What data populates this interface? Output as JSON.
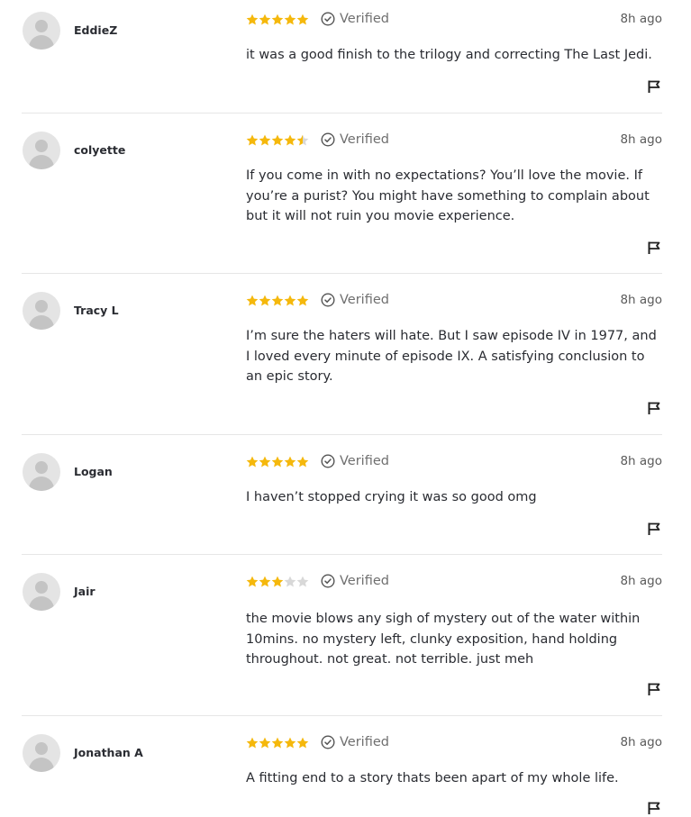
{
  "colors": {
    "star_filled": "#f5b80c",
    "star_empty": "#d8d8d8",
    "text": "#2a2c32",
    "muted": "#6f6f6f",
    "divider": "#e6e6e6"
  },
  "reviews": [
    {
      "username": "EddieZ",
      "rating": 5,
      "verified_label": "Verified",
      "time": "8h ago",
      "text": "it was a good finish to the trilogy and correcting The Last Jedi."
    },
    {
      "username": "colyette",
      "rating": 4.5,
      "verified_label": "Verified",
      "time": "8h ago",
      "text": "If you come in with no expectations? You’ll love the movie. If you’re a purist? You might have something to complain about but it will not ruin you movie experience."
    },
    {
      "username": "Tracy L",
      "rating": 5,
      "verified_label": "Verified",
      "time": "8h ago",
      "text": "I’m sure the haters will hate. But I saw episode IV in 1977, and I loved every minute of episode IX. A satisfying conclusion to an epic story."
    },
    {
      "username": "Logan",
      "rating": 5,
      "verified_label": "Verified",
      "time": "8h ago",
      "text": "I haven’t stopped crying it was so good omg"
    },
    {
      "username": "Jair",
      "rating": 3,
      "verified_label": "Verified",
      "time": "8h ago",
      "text": "the movie blows any sigh of mystery out of the water within 10mins. no mystery left, clunky exposition, hand holding throughout. not great. not terrible. just meh"
    },
    {
      "username": "Jonathan A",
      "rating": 5,
      "verified_label": "Verified",
      "time": "8h ago",
      "text": "A fitting end to a story thats been apart of my whole life."
    }
  ]
}
